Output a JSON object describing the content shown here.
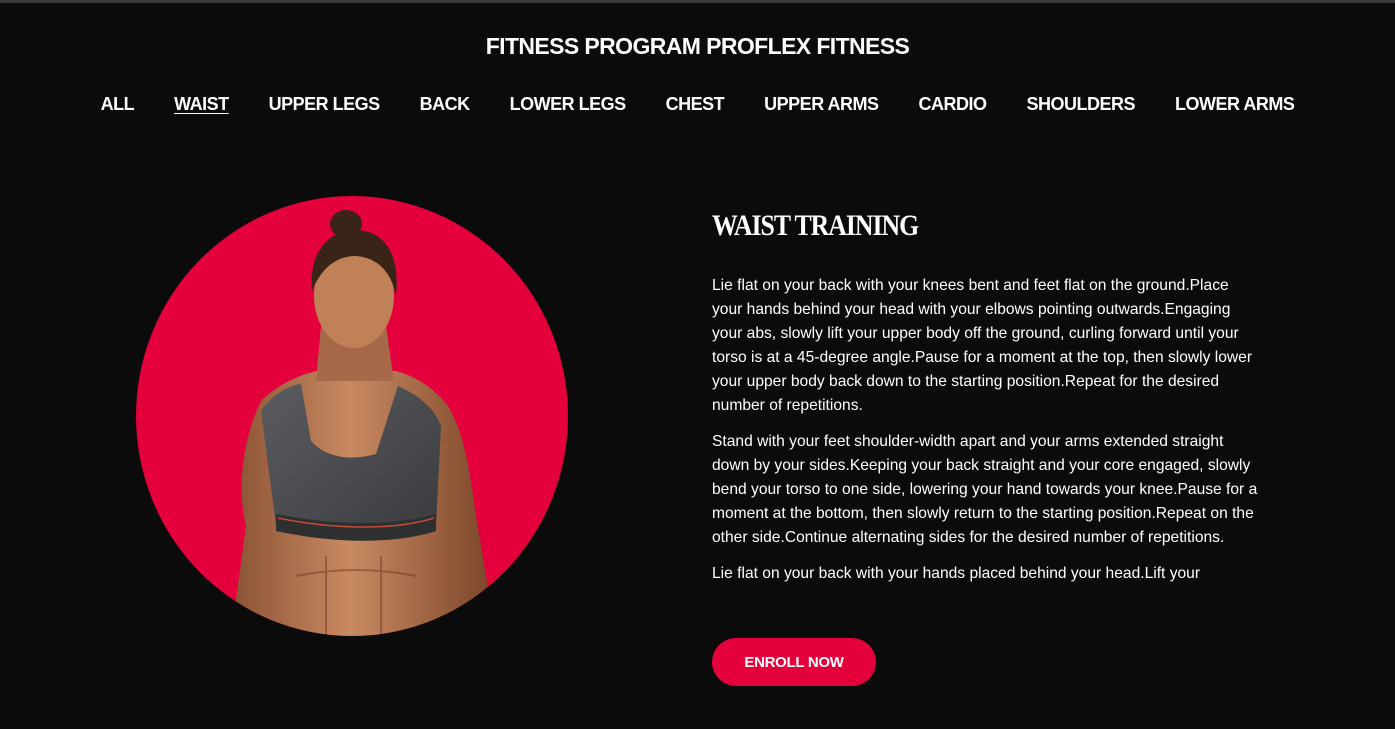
{
  "header": {
    "title": "FITNESS PROGRAM PROFLEX FITNESS"
  },
  "nav": {
    "items": [
      {
        "label": "ALL",
        "active": false
      },
      {
        "label": "WAIST",
        "active": true
      },
      {
        "label": "UPPER LEGS",
        "active": false
      },
      {
        "label": "BACK",
        "active": false
      },
      {
        "label": "LOWER LEGS",
        "active": false
      },
      {
        "label": "CHEST",
        "active": false
      },
      {
        "label": "UPPER ARMS",
        "active": false
      },
      {
        "label": "CARDIO",
        "active": false
      },
      {
        "label": "SHOULDERS",
        "active": false
      },
      {
        "label": "LOWER ARMS",
        "active": false
      }
    ]
  },
  "program": {
    "title": "WAIST TRAINING",
    "paragraphs": [
      "Lie flat on your back with your knees bent and feet flat on the ground.Place your hands behind your head with your elbows pointing outwards.Engaging your abs, slowly lift your upper body off the ground, curling forward until your torso is at a 45-degree angle.Pause for a moment at the top, then slowly lower your upper body back down to the starting position.Repeat for the desired number of repetitions.",
      "Stand with your feet shoulder-width apart and your arms extended straight down by your sides.Keeping your back straight and your core engaged, slowly bend your torso to one side, lowering your hand towards your knee.Pause for a moment at the bottom, then slowly return to the starting position.Repeat on the other side.Continue alternating sides for the desired number of repetitions.",
      "Lie flat on your back with your hands placed behind your head.Lift your"
    ],
    "enroll_label": "ENROLL NOW"
  },
  "colors": {
    "background": "#0b0b0b",
    "accent": "#e4003a",
    "text": "#ffffff"
  }
}
